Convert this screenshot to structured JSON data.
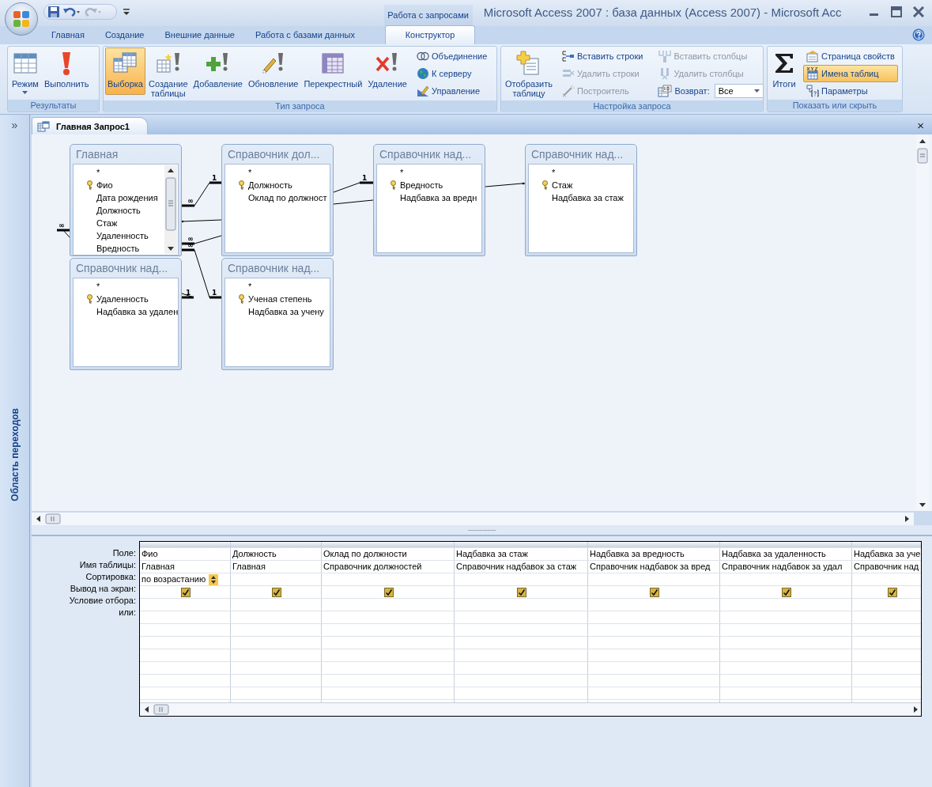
{
  "window": {
    "title": "Microsoft Access 2007 : база данных (Access 2007) - Microsoft Acc",
    "contextual_tab": "Работа с запросами"
  },
  "ribbon_tabs": [
    {
      "label": "Главная",
      "selected": false
    },
    {
      "label": "Создание",
      "selected": false
    },
    {
      "label": "Внешние данные",
      "selected": false
    },
    {
      "label": "Работа с базами данных",
      "selected": false
    },
    {
      "label": "Конструктор",
      "selected": true
    }
  ],
  "ribbon_groups": [
    {
      "label": "Результаты",
      "large_buttons": [
        {
          "label": "Режим",
          "dropdown": true,
          "selected": false
        },
        {
          "label": "Выполнить",
          "dropdown": false,
          "selected": false
        }
      ]
    },
    {
      "label": "Тип запроса",
      "large_buttons": [
        {
          "label": "Выборка",
          "dropdown": false,
          "selected": true
        },
        {
          "label": "Создание таблицы",
          "dropdown": false,
          "selected": false
        },
        {
          "label": "Добавление",
          "dropdown": false,
          "selected": false
        },
        {
          "label": "Обновление",
          "dropdown": false,
          "selected": false
        },
        {
          "label": "Перекрестный",
          "dropdown": false,
          "selected": false
        },
        {
          "label": "Удаление",
          "dropdown": false,
          "selected": false
        }
      ],
      "small_buttons": [
        {
          "label": "Объединение",
          "disabled": false,
          "selected": false
        },
        {
          "label": "К серверу",
          "disabled": false,
          "selected": false
        },
        {
          "label": "Управление",
          "disabled": false,
          "selected": false
        }
      ]
    },
    {
      "label": "Настройка запроса",
      "large_buttons": [
        {
          "label": "Отобразить таблицу",
          "dropdown": false,
          "selected": false
        }
      ],
      "small_buttons": [
        {
          "label": "Вставить строки",
          "disabled": false,
          "selected": false
        },
        {
          "label": "Удалить строки",
          "disabled": true,
          "selected": false
        },
        {
          "label": "Построитель",
          "disabled": true,
          "selected": false
        },
        {
          "label": "Вставить столбцы",
          "disabled": true,
          "selected": false
        },
        {
          "label": "Удалить столбцы",
          "disabled": true,
          "selected": false
        }
      ],
      "return_field": {
        "label": "Возврат:",
        "value": "Все"
      }
    },
    {
      "label": "Показать или скрыть",
      "large_buttons": [
        {
          "label": "Итоги",
          "dropdown": false,
          "selected": false
        }
      ],
      "small_buttons": [
        {
          "label": "Страница свойств",
          "disabled": false,
          "selected": false
        },
        {
          "label": "Имена таблиц",
          "disabled": false,
          "selected": true
        },
        {
          "label": "Параметры",
          "disabled": false,
          "selected": false
        }
      ]
    }
  ],
  "nav_pane": {
    "toggle": "»",
    "title": "Область переходов"
  },
  "document": {
    "tab": "Главная Запрос1",
    "close": "×"
  },
  "query_tables": [
    {
      "title": "Главная",
      "scrollable": true,
      "fields": [
        {
          "name": "*",
          "key": false
        },
        {
          "name": "Фио",
          "key": true
        },
        {
          "name": "Дата рождения",
          "key": false
        },
        {
          "name": "Должность",
          "key": false
        },
        {
          "name": "Стаж",
          "key": false
        },
        {
          "name": "Удаленность",
          "key": false
        },
        {
          "name": "Вредность",
          "key": false
        }
      ]
    },
    {
      "title": "Справочник дол...",
      "scrollable": false,
      "fields": [
        {
          "name": "*",
          "key": false
        },
        {
          "name": "Должность",
          "key": true
        },
        {
          "name": "Оклад по должност",
          "key": false
        }
      ]
    },
    {
      "title": "Справочник над...",
      "scrollable": false,
      "fields": [
        {
          "name": "*",
          "key": false
        },
        {
          "name": "Вредность",
          "key": true
        },
        {
          "name": "Надбавка за вредн",
          "key": false
        }
      ]
    },
    {
      "title": "Справочник над...",
      "scrollable": false,
      "fields": [
        {
          "name": "*",
          "key": false
        },
        {
          "name": "Стаж",
          "key": true
        },
        {
          "name": "Надбавка за стаж",
          "key": false
        }
      ]
    },
    {
      "title": "Справочник над...",
      "scrollable": false,
      "fields": [
        {
          "name": "*",
          "key": false
        },
        {
          "name": "Удаленность",
          "key": true
        },
        {
          "name": "Надбавка за удален",
          "key": false
        }
      ]
    },
    {
      "title": "Справочник над...",
      "scrollable": false,
      "fields": [
        {
          "name": "*",
          "key": false
        },
        {
          "name": "Ученая степень",
          "key": true
        },
        {
          "name": "Надбавка за учену",
          "key": false
        }
      ]
    }
  ],
  "join_labels": [
    "∞",
    "1",
    "∞",
    "∞",
    "1",
    "1",
    "∞",
    "1"
  ],
  "grid": {
    "row_labels": [
      "Поле:",
      "Имя таблицы:",
      "Сортировка:",
      "Вывод на экран:",
      "Условие отбора:",
      "или:"
    ],
    "columns": [
      {
        "field": "Фио",
        "table": "Главная",
        "sort": "по возрастанию",
        "show": true
      },
      {
        "field": "Должность",
        "table": "Главная",
        "show": true
      },
      {
        "field": "Оклад по должности",
        "table": "Справочник должностей",
        "show": true
      },
      {
        "field": "Надбавка за стаж",
        "table": "Справочник надбавок за стаж",
        "show": true
      },
      {
        "field": "Надбавка за вредность",
        "table": "Справочник надбавок за вред",
        "show": true
      },
      {
        "field": "Надбавка за удаленность",
        "table": "Справочник надбавок за удал",
        "show": true
      },
      {
        "field": "Надбавка за уче",
        "table": "Справочник над",
        "show": true
      }
    ]
  }
}
